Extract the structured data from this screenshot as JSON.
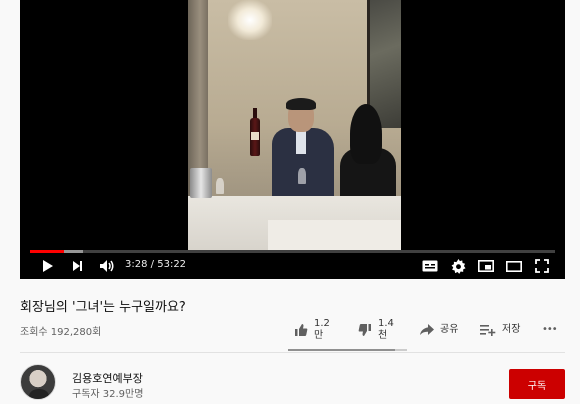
{
  "player": {
    "current_time": "3:28",
    "separator": "/",
    "duration": "53:22",
    "progress_played": 0.065,
    "progress_loaded": 0.1
  },
  "video": {
    "title": "회장님의 '그녀'는 누구일까요?",
    "views": "조회수 192,280회"
  },
  "actions": {
    "like_count_line1": "1.2",
    "like_count_line2": "만",
    "dislike_count_line1": "1.4",
    "dislike_count_line2": "천",
    "share_label": "공유",
    "save_label": "저장",
    "more_label": "•••",
    "like_ratio": 0.9
  },
  "channel": {
    "name": "김용호연예부장",
    "subscribers": "구독자 32.9만명",
    "subscribe_label": "구독"
  },
  "icons": {
    "play": "play-icon",
    "next": "next-icon",
    "volume": "volume-icon",
    "subtitles": "subtitles-icon",
    "settings": "gear-icon",
    "miniplayer": "miniplayer-icon",
    "theater": "theater-mode-icon",
    "fullscreen": "fullscreen-icon",
    "like": "thumbs-up-icon",
    "dislike": "thumbs-down-icon",
    "share": "share-icon",
    "save": "playlist-add-icon"
  },
  "colors": {
    "progress": "#ff0000",
    "subscribe": "#cc0000"
  }
}
